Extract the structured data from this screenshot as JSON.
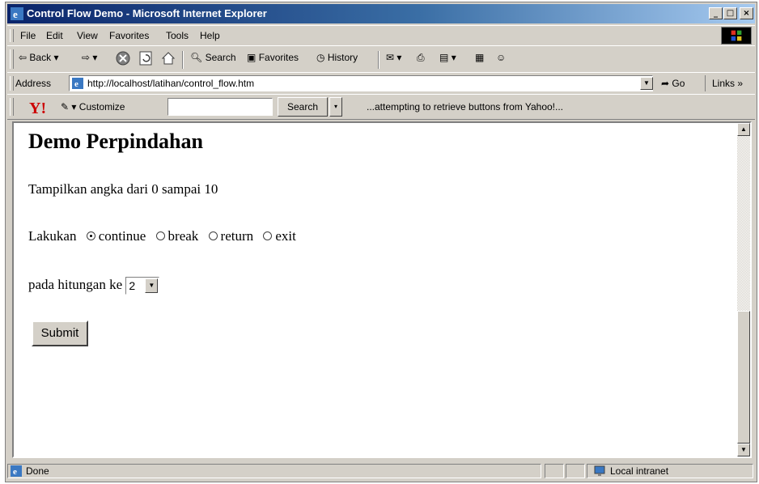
{
  "window": {
    "title": "Control Flow Demo - Microsoft Internet Explorer",
    "controls": {
      "minimize": "_",
      "maximize": "□",
      "close": "×"
    }
  },
  "menu": [
    "File",
    "Edit",
    "View",
    "Favorites",
    "Tools",
    "Help"
  ],
  "toolbar": {
    "back": "Back",
    "search": "Search",
    "favorites": "Favorites",
    "history": "History"
  },
  "address": {
    "label": "Address",
    "url": "http://localhost/latihan/control_flow.htm",
    "go": "Go",
    "links": "Links »"
  },
  "yahoo": {
    "customize": "Customize",
    "search_value": "",
    "search_button": "Search",
    "status": "...attempting to retrieve buttons from Yahoo!..."
  },
  "page": {
    "heading": "Demo Perpindahan",
    "description": "Tampilkan angka dari 0 sampai 10",
    "action_label": "Lakukan",
    "options": [
      {
        "label": "continue",
        "checked": true
      },
      {
        "label": "break",
        "checked": false
      },
      {
        "label": "return",
        "checked": false
      },
      {
        "label": "exit",
        "checked": false
      }
    ],
    "count_label": "pada hitungan ke",
    "count_value": "2",
    "submit": "Submit"
  },
  "status": {
    "text": "Done",
    "zone": "Local intranet"
  },
  "icons": {
    "title": "ie-logo-icon",
    "back": "back-arrow-icon",
    "forward": "forward-arrow-icon",
    "stop": "stop-icon",
    "refresh": "refresh-icon",
    "home": "home-icon",
    "search": "search-icon",
    "favorites": "favorites-icon",
    "history": "history-icon",
    "mail": "mail-icon",
    "print": "print-icon",
    "edit": "edit-icon",
    "discuss": "discuss-icon",
    "messenger": "messenger-icon"
  },
  "colors": {
    "titlebar_start": "#0a246a",
    "titlebar_end": "#a6caf0",
    "chrome": "#d4d0c8",
    "yahoo_red": "#cc0000"
  }
}
